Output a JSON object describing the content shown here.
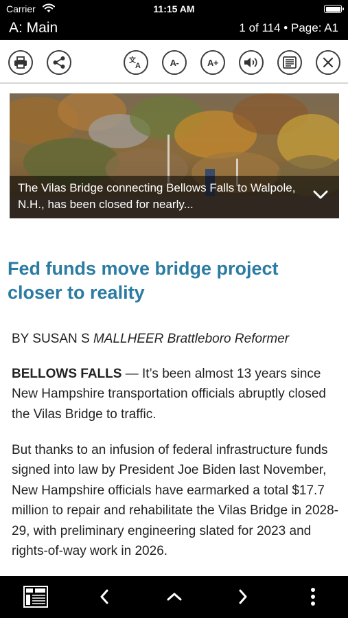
{
  "status_bar": {
    "carrier": "Carrier",
    "time": "11:15 AM"
  },
  "nav": {
    "section": "A: Main",
    "position": "1 of 114 • Page: A1"
  },
  "toolbar": {
    "print": "printer-icon",
    "share": "share-icon",
    "translate": "translate-icon",
    "font_decrease_label": "A-",
    "font_increase_label": "A+",
    "audio": "speaker-icon",
    "text_view": "text-view-icon",
    "close": "close-icon"
  },
  "article": {
    "photo_caption": "The Vilas Bridge connecting Bellows Falls to Walpole, N.H., has been closed for nearly...",
    "headline": "Fed funds move bridge project closer to reality",
    "byline_prefix": "BY SUSAN S ",
    "byline_italic": "MALLHEER Brattleboro Reformer",
    "p1_dateline": "BELLOWS FALLS",
    "p1_body": " — It’s been almost 13 years since New Hampshire transportation officials abruptly closed the Vilas Bridge to traffic.",
    "p2_body": "But thanks to an infusion of federal infrastructure funds signed into law by President Joe Biden last November, New Hampshire officials have earmarked a total $17.7 million to repair and rehabilitate the Vilas Bridge in 2028-29, with preliminary engineering slated for 2023 and rights-of-way work in 2026."
  },
  "colors": {
    "headline": "#2b7ba3",
    "bars": "#000000"
  },
  "bottom_bar": {
    "pages": "page-thumbnail-icon",
    "previous": "chevron-left-icon",
    "up": "chevron-up-icon",
    "next": "chevron-right-icon",
    "more": "more-vertical-icon"
  }
}
